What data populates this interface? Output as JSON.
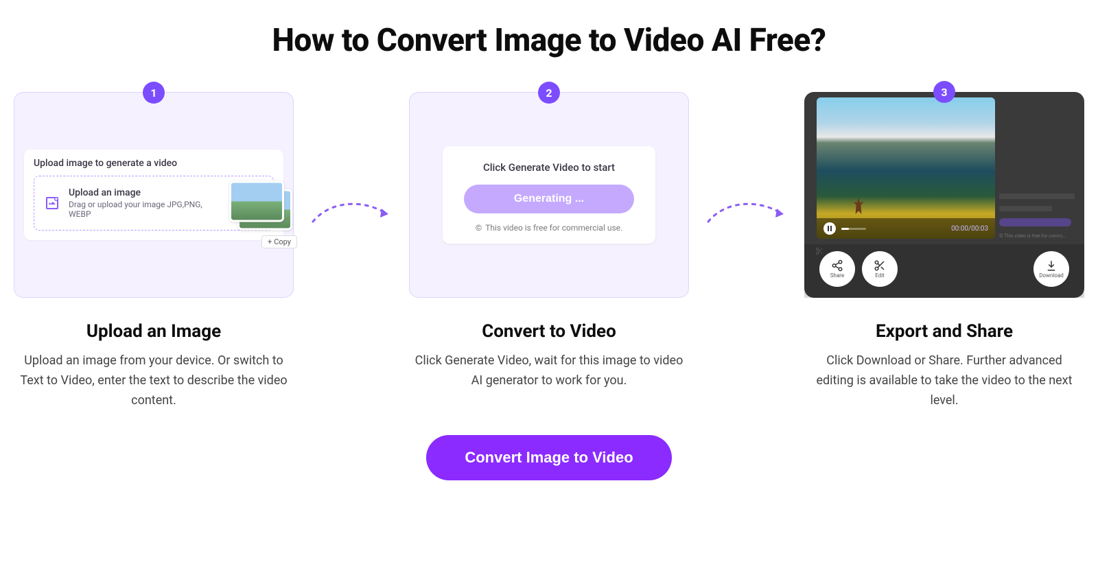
{
  "page": {
    "title": "How to Convert Image to Video AI Free?",
    "cta_label": "Convert Image to Video"
  },
  "steps": [
    {
      "badge": "1",
      "title": "Upload an Image",
      "description": "Upload an image from your device. Or switch to Text to Video, enter the text to describe the video content.",
      "panel": {
        "heading": "Upload image to generate a video",
        "main": "Upload an image",
        "sub": "Drag or upload your image JPG,PNG, WEBP",
        "copy": "Copy"
      }
    },
    {
      "badge": "2",
      "title": "Convert to Video",
      "description": "Click Generate Video, wait for this image to video AI generator to work for you.",
      "panel": {
        "heading": "Click Generate Video to start",
        "button": "Generating ...",
        "note": "This video is free for commercial use."
      }
    },
    {
      "badge": "3",
      "title": "Export and Share",
      "description": "Click Download or Share. Further advanced editing is available to take the video to the next level.",
      "player": {
        "time": "00:00/00:03",
        "share": "Share",
        "edit": "Edit",
        "download": "Download"
      }
    }
  ]
}
